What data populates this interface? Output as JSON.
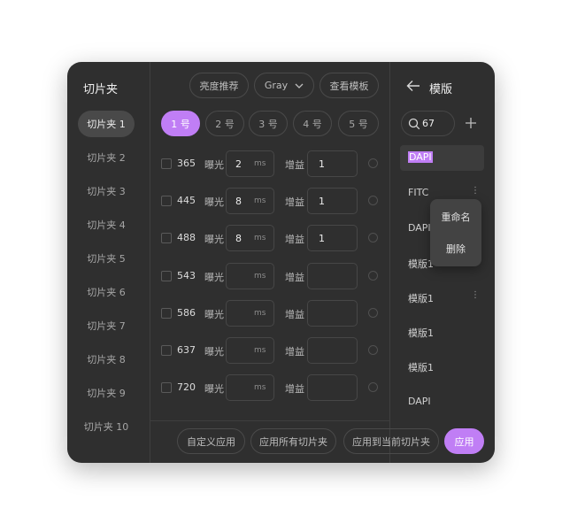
{
  "sidebar": {
    "title": "切片夹",
    "items": [
      "切片夹 1",
      "切片夹 2",
      "切片夹 3",
      "切片夹 4",
      "切片夹 5",
      "切片夹 6",
      "切片夹 7",
      "切片夹 8",
      "切片夹 9",
      "切片夹 10"
    ],
    "active_index": 0
  },
  "toolbar": {
    "brightness": "亮度推荐",
    "color": "Gray",
    "view_template": "查看模板"
  },
  "slots": {
    "items": [
      "1 号",
      "2 号",
      "3 号",
      "4 号",
      "5 号"
    ],
    "active_index": 0
  },
  "channels": {
    "exposure_label": "曝光",
    "gain_label": "增益",
    "unit": "ms",
    "rows": [
      {
        "wavelength": "365",
        "exposure": "2",
        "gain": "1"
      },
      {
        "wavelength": "445",
        "exposure": "8",
        "gain": "1"
      },
      {
        "wavelength": "488",
        "exposure": "8",
        "gain": "1"
      },
      {
        "wavelength": "543",
        "exposure": "",
        "gain": ""
      },
      {
        "wavelength": "586",
        "exposure": "",
        "gain": ""
      },
      {
        "wavelength": "637",
        "exposure": "",
        "gain": ""
      },
      {
        "wavelength": "720",
        "exposure": "",
        "gain": ""
      }
    ]
  },
  "footer": {
    "custom": "自定义应用",
    "apply_all": "应用所有切片夹",
    "apply_current": "应用到当前切片夹",
    "apply": "应用"
  },
  "template_panel": {
    "title": "模版",
    "search_value": "67",
    "items": [
      "DAPI",
      "FITC",
      "DAPI",
      "模版1",
      "模版1",
      "模版1",
      "模版1",
      "DAPI"
    ],
    "selected_index": 0
  },
  "context_menu": {
    "rename": "重命名",
    "delete": "删除"
  },
  "colors": {
    "accent": "#c07ef5",
    "panel": "#2f2f2f"
  }
}
